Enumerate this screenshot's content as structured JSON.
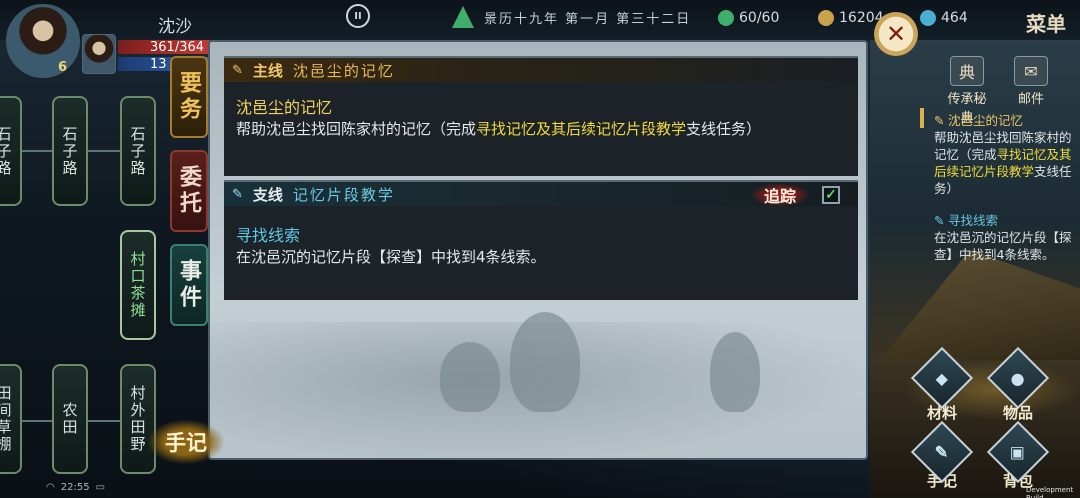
{
  "player": {
    "name": "沈沙",
    "level": "6",
    "hp": "361/364",
    "mp": "13",
    "mp_level": "6"
  },
  "hud": {
    "pause_label": "II",
    "date": "景历十九年 第一月 第三十二日",
    "stamina": "60/60",
    "money": "16204",
    "gems": "464",
    "menu_label": "菜单"
  },
  "map": {
    "nodes": [
      {
        "label": "石子路"
      },
      {
        "label": "石子路"
      },
      {
        "label": "石子路"
      },
      {
        "label": "村口茶摊"
      },
      {
        "label": "田间草棚"
      },
      {
        "label": "农田"
      },
      {
        "label": "村外田野"
      }
    ]
  },
  "tabs": {
    "main": "要务",
    "entrust": "委托",
    "event": "事件"
  },
  "quests": {
    "main": {
      "type": "主线",
      "header_title": "沈邑尘的记忆",
      "title": "沈邑尘的记忆",
      "desc_prefix": "帮助沈邑尘找回陈家村的记忆（完成",
      "desc_highlight": "寻找记忆及其后续记忆片段教学",
      "desc_suffix": "支线任务）"
    },
    "side": {
      "type": "支线",
      "header_title": "记忆片段教学",
      "track_label": "追踪",
      "track_checked": "✓",
      "title": "寻找线索",
      "desc": "在沈邑沉的记忆片段【探查】中找到4条线索。"
    }
  },
  "close_label": "✕",
  "sidebar": {
    "icons": [
      {
        "label": "传承秘典",
        "glyph": "典"
      },
      {
        "label": "邮件",
        "glyph": "✉"
      }
    ],
    "tracker_main_title": "沈邑尘的记忆",
    "tracker_main_desc_prefix": "帮助沈邑尘找回陈家村的记忆（完成",
    "tracker_main_desc_highlight": "寻找记忆及其后续记忆片段教学",
    "tracker_main_desc_suffix": "支线任务）",
    "tracker_side_title": "寻找线索",
    "tracker_side_desc": "在沈邑沉的记忆片段【探查】中找到4条线索。",
    "buttons": [
      {
        "label": "材料"
      },
      {
        "label": "物品"
      },
      {
        "label": "手记"
      },
      {
        "label": "背包"
      }
    ]
  },
  "handbook_label": "手记",
  "status": {
    "time": "22:55"
  },
  "build_label": "Development Build",
  "colors": {
    "main_accent": "#f2d25a",
    "side_accent": "#5fc7e6",
    "highlight": "#f0dc3c"
  }
}
